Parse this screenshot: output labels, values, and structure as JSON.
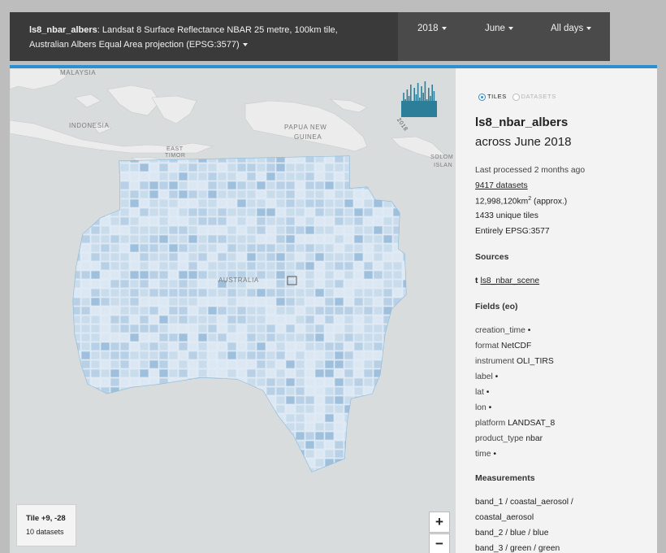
{
  "header": {
    "product_name": "ls8_nbar_albers",
    "description_line1": ": Landsat 8 Surface Reflectance NBAR 25 metre, 100km tile,",
    "description_line2": "Australian Albers Equal Area projection (EPSG:3577)",
    "year_filter": "2018",
    "month_filter": "June",
    "day_filter": "All days"
  },
  "map": {
    "labels": {
      "malaysia": "MALAYSIA",
      "indonesia": "INDONESIA",
      "papua_new_guinea_1": "PAPUA NEW",
      "papua_new_guinea_2": "GUINEA",
      "east_timor_1": "EAST",
      "east_timor_2": "TIMOR",
      "solomon_1": "SOLOM",
      "solomon_2": "ISLAN",
      "australia": "AUSTRALIA"
    },
    "histogram_year": "2018",
    "tile_info": {
      "title": "Tile +9, -28",
      "datasets": "10 datasets"
    },
    "zoom_in": "+",
    "zoom_out": "−"
  },
  "sidebar": {
    "view_toggle": {
      "tiles": "TILES",
      "datasets": "DATASETS",
      "selected": "tiles"
    },
    "product_name": "ls8_nbar_albers",
    "period": "across June 2018",
    "last_processed": "Last processed 2 months ago",
    "dataset_count": "9417 datasets",
    "area_prefix": "12,998,120km",
    "area_sup": "2",
    "area_suffix": " (approx.)",
    "unique_tiles": "1433 unique tiles",
    "crs": "Entirely EPSG:3577",
    "sources_heading": "Sources",
    "source_icon": "t",
    "source_link": "ls8_nbar_scene",
    "fields_heading": "Fields (eo)",
    "fields": [
      {
        "key": "creation_time",
        "value": "•"
      },
      {
        "key": "format",
        "value": "NetCDF"
      },
      {
        "key": "instrument",
        "value": "OLI_TIRS"
      },
      {
        "key": "label",
        "value": "•"
      },
      {
        "key": "lat",
        "value": "•"
      },
      {
        "key": "lon",
        "value": "•"
      },
      {
        "key": "platform",
        "value": "LANDSAT_8"
      },
      {
        "key": "product_type",
        "value": "nbar"
      },
      {
        "key": "time",
        "value": "•"
      }
    ],
    "measurements_heading": "Measurements",
    "measurements": [
      "band_1 / coastal_aerosol /",
      "coastal_aerosol",
      "band_2 / blue / blue",
      "band_3 / green / green"
    ]
  },
  "colors": {
    "accent": "#2c8fd0",
    "header_bg": "#3a3a3a",
    "tile_base": "#c8dcec",
    "histogram": "#2d7f99"
  }
}
